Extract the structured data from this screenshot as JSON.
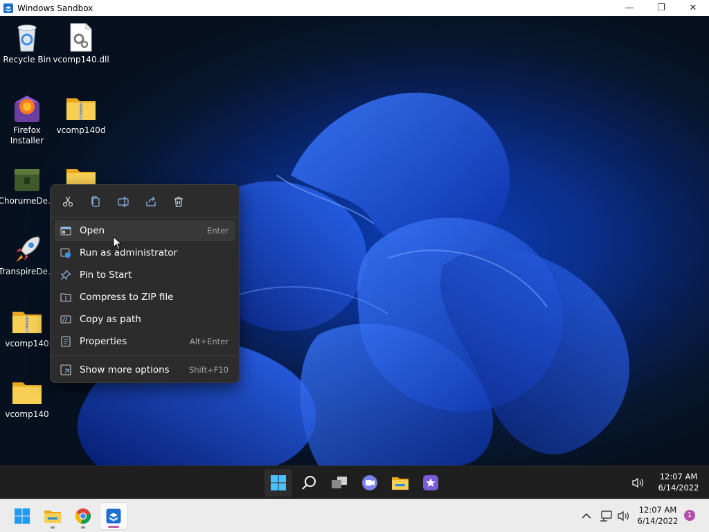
{
  "window": {
    "title": "Windows Sandbox",
    "minimize": "—",
    "maximize": "❐",
    "close": "✕"
  },
  "desktop": {
    "icons": [
      {
        "label": "Recycle Bin",
        "icon": "recycle-bin-icon"
      },
      {
        "label": "vcomp140.dll",
        "icon": "dll-file-icon"
      },
      {
        "label": "Firefox Installer",
        "icon": "firefox-installer-icon"
      },
      {
        "label": "vcomp140d",
        "icon": "zip-folder-icon"
      },
      {
        "label": "ChorumeDe...",
        "icon": "chorume-app-icon"
      },
      {
        "label": "",
        "icon": "folder-icon"
      },
      {
        "label": "TranspireDe...",
        "icon": "rocket-icon"
      },
      {
        "label": "vcomp140",
        "icon": "zip-folder-icon"
      },
      {
        "label": "vcomp140",
        "icon": "folder-icon"
      }
    ]
  },
  "context_menu": {
    "quick_actions": [
      {
        "name": "cut",
        "icon": "scissors-icon"
      },
      {
        "name": "copy",
        "icon": "copy-icon"
      },
      {
        "name": "rename",
        "icon": "rename-icon"
      },
      {
        "name": "share",
        "icon": "share-icon"
      },
      {
        "name": "delete",
        "icon": "trash-icon"
      }
    ],
    "items": [
      {
        "label": "Open",
        "accel": "Enter",
        "icon": "open-window-icon"
      },
      {
        "label": "Run as administrator",
        "accel": "",
        "icon": "shield-icon"
      },
      {
        "label": "Pin to Start",
        "accel": "",
        "icon": "pin-icon"
      },
      {
        "label": "Compress to ZIP file",
        "accel": "",
        "icon": "zip-icon"
      },
      {
        "label": "Copy as path",
        "accel": "",
        "icon": "path-icon"
      },
      {
        "label": "Properties",
        "accel": "Alt+Enter",
        "icon": "properties-icon"
      },
      {
        "label": "Show more options",
        "accel": "Shift+F10",
        "icon": "more-options-icon"
      }
    ]
  },
  "sandbox_taskbar": {
    "apps": [
      "start",
      "search",
      "task-view",
      "chat",
      "file-explorer",
      "store"
    ],
    "time": "12:07 AM",
    "date": "6/14/2022"
  },
  "host_taskbar": {
    "apps": [
      "start",
      "file-explorer",
      "chrome",
      "windows-sandbox"
    ],
    "time": "12:07 AM",
    "date": "6/14/2022",
    "notification_count": "1"
  },
  "colors": {
    "accent": "#0a64d8",
    "menu_bg": "#2c2c2c",
    "folder": "#f4c542"
  }
}
